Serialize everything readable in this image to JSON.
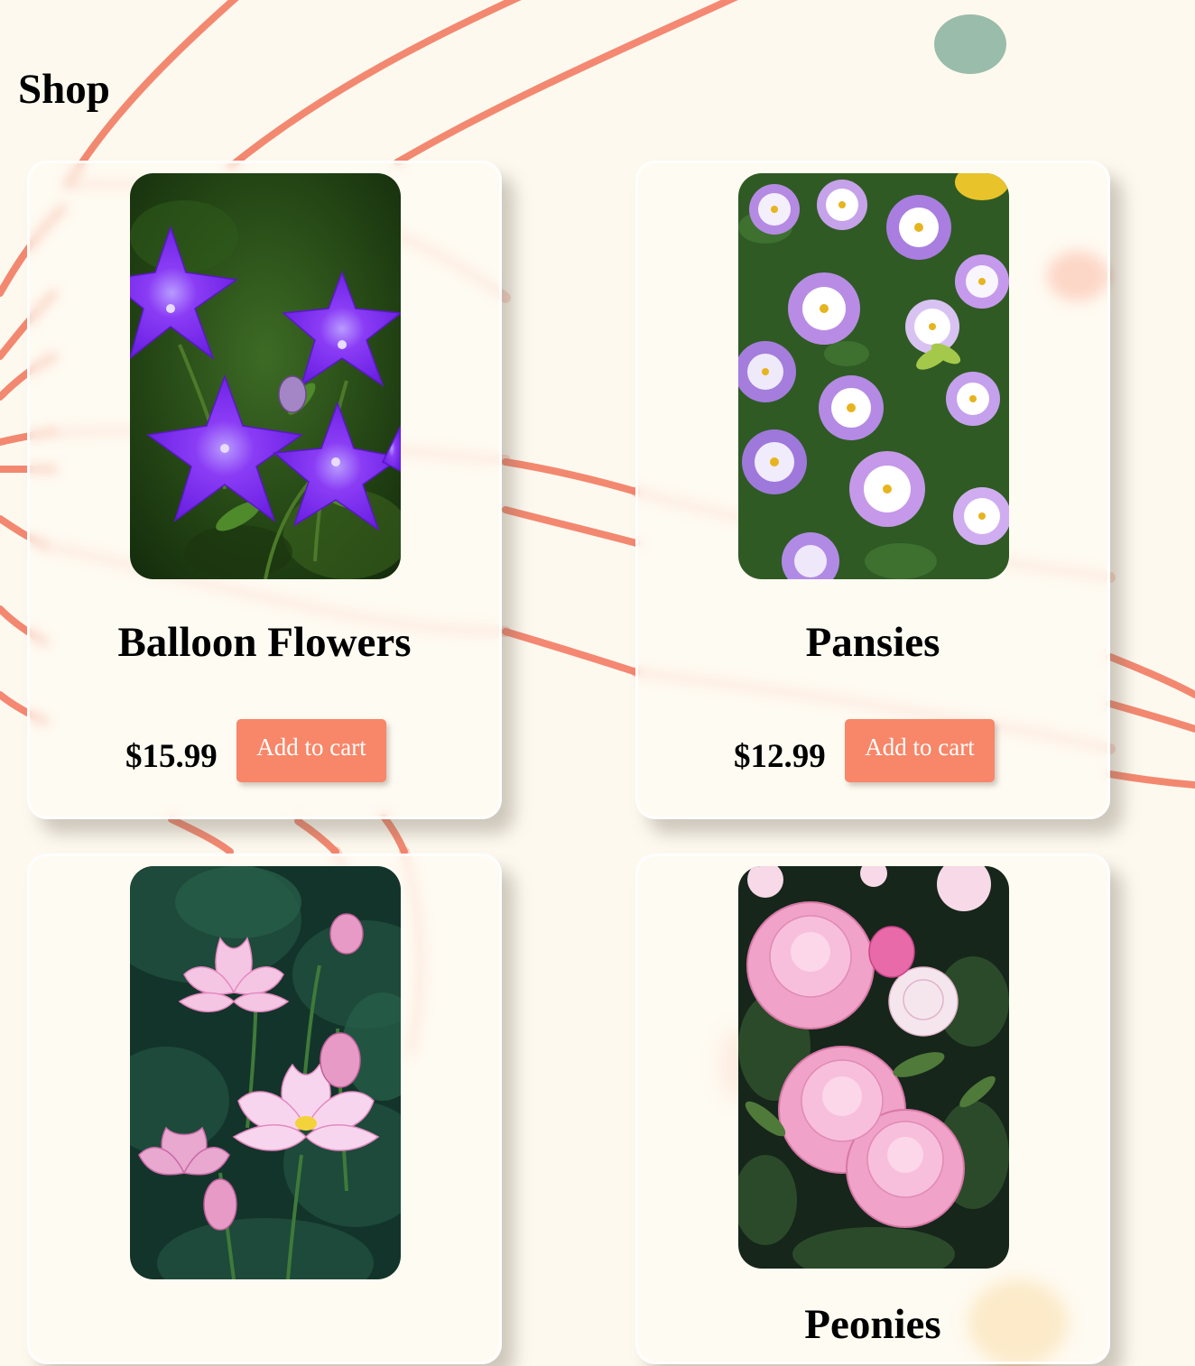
{
  "page": {
    "title": "Shop"
  },
  "theme": {
    "background": "#fdf9ef",
    "accent": "#f88668",
    "button_text": "#ffffff"
  },
  "products": [
    {
      "name": "Balloon Flowers",
      "price": "$15.99",
      "button_label": "Add to cart",
      "photo": "balloon-flowers-photo",
      "colors": [
        "#7a2ff0",
        "#233f14"
      ]
    },
    {
      "name": "Pansies",
      "price": "$12.99",
      "button_label": "Add to cart",
      "photo": "pansies-photo",
      "colors": [
        "#b58ae3",
        "#ffffff"
      ]
    },
    {
      "name": "",
      "price": "",
      "button_label": "",
      "photo": "lotus-photo",
      "colors": [
        "#f5c6e4",
        "#13342a"
      ]
    },
    {
      "name": "Peonies",
      "price": "",
      "button_label": "",
      "photo": "peonies-photo",
      "colors": [
        "#f0a2c8",
        "#16261a"
      ]
    }
  ]
}
